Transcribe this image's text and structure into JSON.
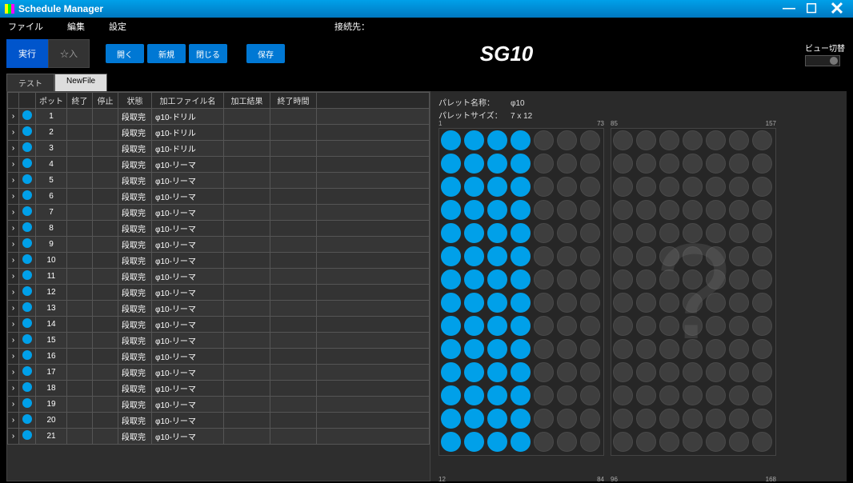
{
  "window": {
    "title": "Schedule Manager"
  },
  "menu": {
    "file": "ファイル",
    "edit": "編集",
    "settings": "設定",
    "connection_label": "接続先："
  },
  "toolbar": {
    "exec": "実行",
    "input": "☆入",
    "open": "開く",
    "new": "新規",
    "close": "閉じる",
    "save": "保存",
    "center_title": "SG10",
    "view_switch_label": "ビュー切替"
  },
  "tabs": {
    "test": "テスト",
    "newfile": "NewFile"
  },
  "table": {
    "headers": {
      "pot": "ポット",
      "end": "終了",
      "stop": "停止",
      "status": "状態",
      "file": "加工ファイル名",
      "result": "加工結果",
      "time": "終了時間"
    },
    "status_value": "段取完",
    "rows": [
      {
        "pot": "1",
        "file": "φ10-ドリル"
      },
      {
        "pot": "2",
        "file": "φ10-ドリル"
      },
      {
        "pot": "3",
        "file": "φ10-ドリル"
      },
      {
        "pot": "4",
        "file": "φ10-リーマ"
      },
      {
        "pot": "5",
        "file": "φ10-リーマ"
      },
      {
        "pot": "6",
        "file": "φ10-リーマ"
      },
      {
        "pot": "7",
        "file": "φ10-リーマ"
      },
      {
        "pot": "8",
        "file": "φ10-リーマ"
      },
      {
        "pot": "9",
        "file": "φ10-リーマ"
      },
      {
        "pot": "10",
        "file": "φ10-リーマ"
      },
      {
        "pot": "11",
        "file": "φ10-リーマ"
      },
      {
        "pot": "12",
        "file": "φ10-リーマ"
      },
      {
        "pot": "13",
        "file": "φ10-リーマ"
      },
      {
        "pot": "14",
        "file": "φ10-リーマ"
      },
      {
        "pot": "15",
        "file": "φ10-リーマ"
      },
      {
        "pot": "16",
        "file": "φ10-リーマ"
      },
      {
        "pot": "17",
        "file": "φ10-リーマ"
      },
      {
        "pot": "18",
        "file": "φ10-リーマ"
      },
      {
        "pot": "19",
        "file": "φ10-リーマ"
      },
      {
        "pot": "20",
        "file": "φ10-リーマ"
      },
      {
        "pot": "21",
        "file": "φ10-リーマ"
      }
    ]
  },
  "palette": {
    "name_label": "パレット名称：",
    "name": "φ10",
    "size_label": "パレットサイズ：",
    "size": "7 x 12",
    "grid1": {
      "corners": {
        "tl": "1",
        "tr": "73",
        "bl": "12",
        "br": "84"
      },
      "cols": 7,
      "rows": 14,
      "filled_columns": 4
    },
    "grid2": {
      "corners": {
        "tl": "85",
        "tr": "157",
        "bl": "96",
        "br": "168"
      },
      "cols": 7,
      "rows": 14,
      "filled_columns": 0,
      "watermark": "?"
    }
  }
}
